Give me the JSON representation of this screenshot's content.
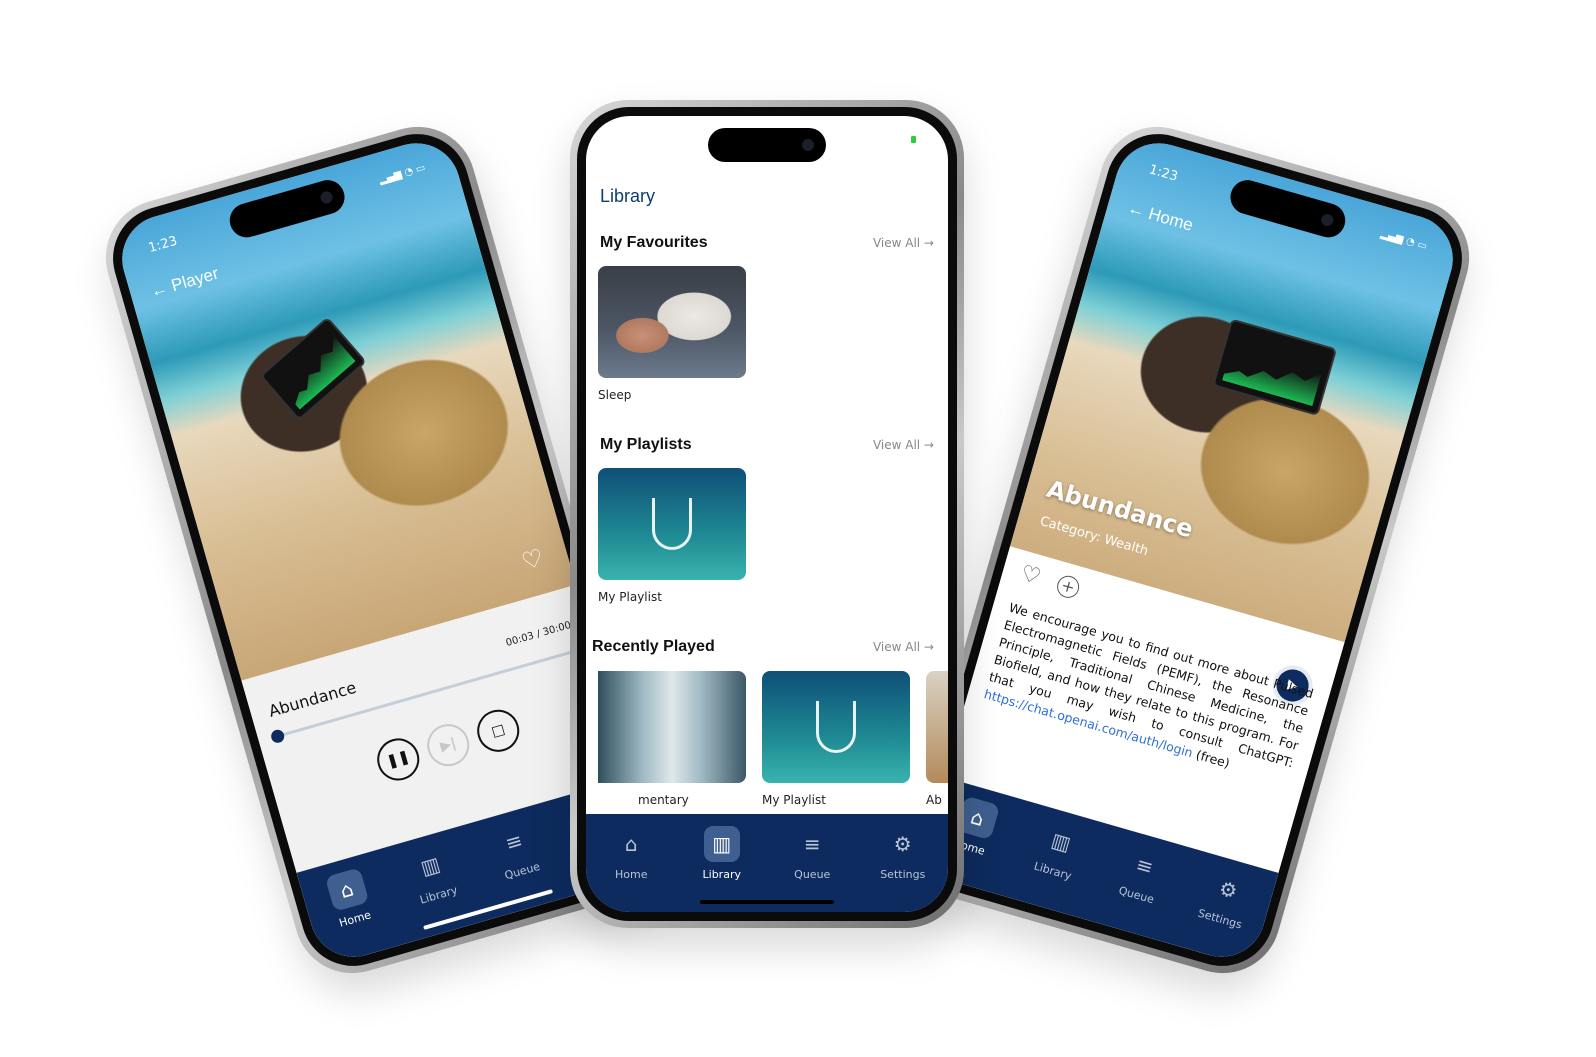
{
  "player": {
    "status_time": "1:23",
    "back_label": "Player",
    "track_title": "Abundance",
    "time": "00:03 / 30:00",
    "progress_percent": 0.2,
    "controls": {
      "pause": "❚❚",
      "skip": "▶|",
      "stop": "□"
    }
  },
  "library": {
    "title": "Library",
    "favourites": {
      "heading": "My Favourites",
      "view_all": "View All →",
      "items": [
        {
          "label": "Sleep"
        }
      ]
    },
    "playlists": {
      "heading": "My Playlists",
      "view_all": "View All →",
      "items": [
        {
          "label": "My Playlist"
        }
      ]
    },
    "recent": {
      "heading": "Recently Played",
      "view_all": "View All →",
      "items": [
        {
          "label": "mentary"
        },
        {
          "label": "My Playlist"
        },
        {
          "label": "Ab"
        }
      ]
    }
  },
  "home": {
    "status_time": "1:23",
    "back_label": "Home",
    "track_title": "Abundance",
    "category": "Category: Wealth",
    "description": "We encourage you to find out more about Pulsed Electromagnetic Fields (PEMF), the Resonance Principle, Traditional Chinese Medicine, the Biofield, and how they relate to this program. For that you may wish to consult ChatGPT: ",
    "link": "https://chat.openai.com/auth/login",
    "link_suffix": " (free)"
  },
  "tabs": [
    {
      "label": "Home",
      "icon": "home-icon"
    },
    {
      "label": "Library",
      "icon": "library-icon"
    },
    {
      "label": "Queue",
      "icon": "queue-icon"
    },
    {
      "label": "Settings",
      "icon": "gear-icon"
    }
  ],
  "colors": {
    "navy": "#0d2b5e",
    "title_blue": "#0d3b73",
    "link": "#2f6fd6"
  }
}
